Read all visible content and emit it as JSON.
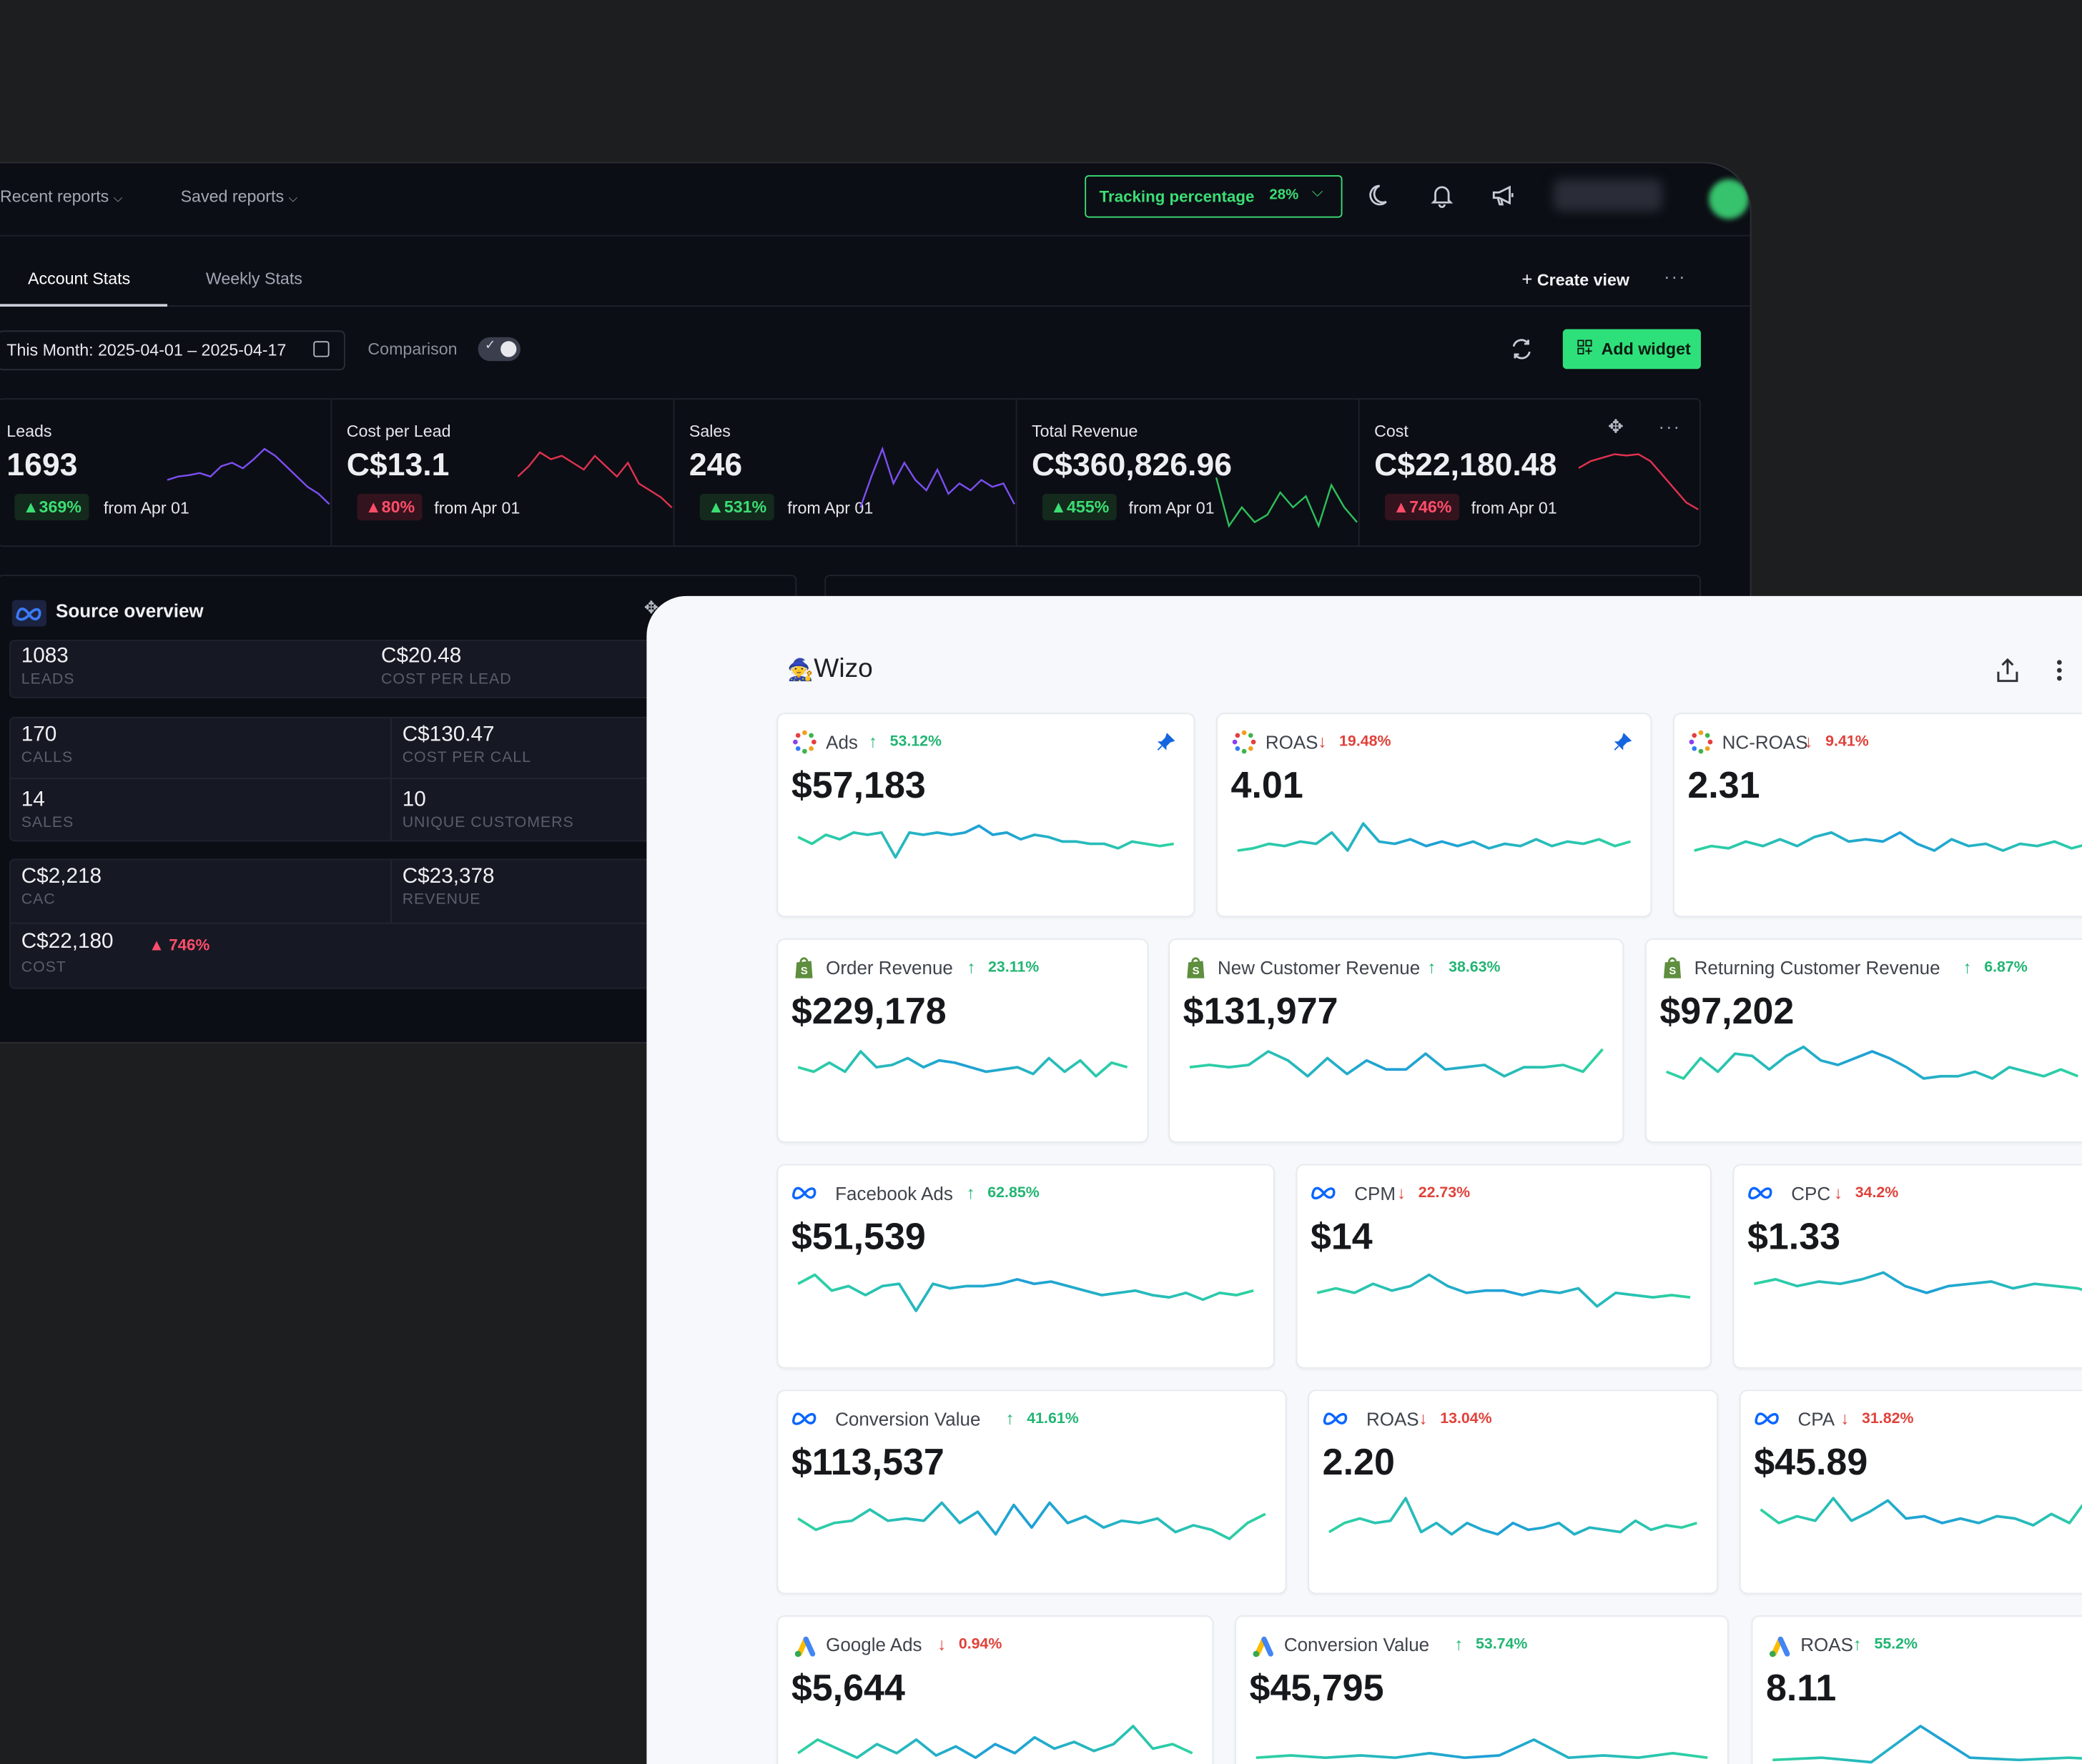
{
  "colors": {
    "accent_green": "#2ee07a",
    "up_green": "#3bde74",
    "down_red": "#ff4d6a",
    "light_up": "#22b573",
    "light_down": "#e0413a"
  },
  "dark_dashboard": {
    "nav": {
      "recent_reports": "Recent reports",
      "saved_reports": "Saved reports",
      "tracking_label": "Tracking percentage",
      "tracking_value": "28%"
    },
    "tabs": [
      "Account Stats",
      "Weekly Stats"
    ],
    "create_view": "Create view",
    "date_range": "This Month: 2025-04-01 – 2025-04-17",
    "comparison": "Comparison",
    "add_widget": "Add widget",
    "kpis": [
      {
        "label": "Leads",
        "value": "1693",
        "change": "369%",
        "dir": "up",
        "from": "from Apr 01",
        "trend": [
          0.55,
          0.5,
          0.48,
          0.45,
          0.5,
          0.35,
          0.3,
          0.38,
          0.25,
          0.1,
          0.2,
          0.35,
          0.5,
          0.65,
          0.75,
          0.9
        ]
      },
      {
        "label": "Cost per Lead",
        "value": "C$13.1",
        "change": "80%",
        "dir": "down",
        "from": "from Apr 01",
        "trend": [
          0.5,
          0.35,
          0.15,
          0.25,
          0.2,
          0.3,
          0.4,
          0.2,
          0.35,
          0.5,
          0.3,
          0.6,
          0.7,
          0.8,
          0.95
        ]
      },
      {
        "label": "Sales",
        "value": "246",
        "change": "531%",
        "dir": "up",
        "from": "from Apr 01",
        "trend": [
          0.95,
          0.5,
          0.1,
          0.6,
          0.3,
          0.55,
          0.7,
          0.4,
          0.75,
          0.6,
          0.7,
          0.55,
          0.65,
          0.6,
          0.9
        ]
      },
      {
        "label": "Total Revenue",
        "value": "C$360,826.96",
        "change": "455%",
        "dir": "up",
        "from": "from Apr 01",
        "trend": [
          0.3,
          0.95,
          0.7,
          0.9,
          0.8,
          0.5,
          0.7,
          0.55,
          0.95,
          0.4,
          0.7,
          0.9
        ]
      },
      {
        "label": "Cost",
        "value": "C$22,180.48",
        "change": "746%",
        "dir": "down",
        "from": "from Apr 01",
        "trend": [
          0.3,
          0.2,
          0.15,
          0.1,
          0.12,
          0.1,
          0.2,
          0.4,
          0.6,
          0.8,
          0.9
        ]
      }
    ],
    "source_overview": {
      "title": "Source overview",
      "rows": [
        {
          "v1": "1083",
          "l1": "LEADS",
          "v2": "C$20.48",
          "l2": "COST PER LEAD"
        },
        {
          "v1": "170",
          "l1": "CALLS",
          "v2": "C$130.47",
          "l2": "COST PER CALL"
        },
        {
          "v1": "14",
          "l1": "SALES",
          "v2": "10",
          "l2": "UNIQUE CUSTOMERS"
        },
        {
          "v1": "C$2,218",
          "l1": "CAC",
          "v2": "C$23,378",
          "l2": "REVENUE"
        },
        {
          "v1": "C$22,180",
          "l1": "COST",
          "badge": "746%"
        }
      ]
    }
  },
  "light_dashboard": {
    "brand": "Wizo",
    "cards": [
      {
        "icon": "ads-ring-icon",
        "title": "Ads",
        "change": "53.12%",
        "dir": "up",
        "value": "$57,183",
        "pinned": true,
        "series": [
          0.4,
          0.55,
          0.35,
          0.45,
          0.3,
          0.35,
          0.3,
          0.85,
          0.3,
          0.35,
          0.3,
          0.35,
          0.3,
          0.15,
          0.35,
          0.3,
          0.45,
          0.35,
          0.4,
          0.5,
          0.5,
          0.55,
          0.55,
          0.65,
          0.5,
          0.55,
          0.6,
          0.55
        ]
      },
      {
        "icon": "ads-ring-icon",
        "title": "ROAS",
        "change": "19.48%",
        "dir": "down",
        "value": "4.01",
        "pinned": true,
        "series": [
          0.7,
          0.65,
          0.55,
          0.6,
          0.5,
          0.55,
          0.3,
          0.7,
          0.1,
          0.5,
          0.55,
          0.45,
          0.6,
          0.5,
          0.6,
          0.5,
          0.65,
          0.55,
          0.6,
          0.45,
          0.6,
          0.5,
          0.55,
          0.45,
          0.6,
          0.5
        ]
      },
      {
        "icon": "ads-ring-icon",
        "title": "NC-ROAS",
        "change": "9.41%",
        "dir": "down",
        "value": "2.31",
        "pinned": false,
        "series": [
          0.7,
          0.6,
          0.65,
          0.5,
          0.6,
          0.45,
          0.6,
          0.4,
          0.3,
          0.5,
          0.45,
          0.5,
          0.3,
          0.55,
          0.7,
          0.45,
          0.6,
          0.55,
          0.7,
          0.55,
          0.6,
          0.5,
          0.65,
          0.55,
          0.6
        ]
      },
      {
        "icon": "shopify-icon",
        "title": "Order Revenue",
        "change": "23.11%",
        "dir": "up",
        "value": "$229,178",
        "pinned": false,
        "series": [
          0.5,
          0.6,
          0.4,
          0.6,
          0.15,
          0.5,
          0.45,
          0.3,
          0.5,
          0.35,
          0.4,
          0.5,
          0.6,
          0.55,
          0.5,
          0.65,
          0.3,
          0.6,
          0.35,
          0.7,
          0.4,
          0.5
        ]
      },
      {
        "icon": "shopify-icon",
        "title": "New Customer Revenue",
        "change": "38.63%",
        "dir": "up",
        "value": "$131,977",
        "pinned": false,
        "series": [
          0.5,
          0.45,
          0.5,
          0.45,
          0.15,
          0.35,
          0.7,
          0.3,
          0.65,
          0.35,
          0.55,
          0.55,
          0.2,
          0.55,
          0.5,
          0.45,
          0.7,
          0.5,
          0.5,
          0.45,
          0.6,
          0.1
        ]
      },
      {
        "icon": "shopify-icon",
        "title": "Returning Customer Revenue",
        "change": "6.87%",
        "dir": "up",
        "value": "$97,202",
        "pinned": false,
        "series": [
          0.6,
          0.75,
          0.3,
          0.6,
          0.2,
          0.25,
          0.55,
          0.25,
          0.05,
          0.35,
          0.45,
          0.3,
          0.15,
          0.3,
          0.5,
          0.75,
          0.7,
          0.7,
          0.6,
          0.75,
          0.5,
          0.6,
          0.7,
          0.55,
          0.7
        ]
      },
      {
        "icon": "meta-icon",
        "title": "Facebook Ads",
        "change": "62.85%",
        "dir": "up",
        "value": "$51,539",
        "pinned": false,
        "series": [
          0.3,
          0.1,
          0.45,
          0.35,
          0.55,
          0.35,
          0.3,
          0.9,
          0.3,
          0.4,
          0.35,
          0.35,
          0.3,
          0.2,
          0.3,
          0.25,
          0.35,
          0.45,
          0.55,
          0.5,
          0.45,
          0.55,
          0.6,
          0.5,
          0.65,
          0.5,
          0.55,
          0.45
        ]
      },
      {
        "icon": "meta-icon",
        "title": "CPM",
        "change": "22.73%",
        "dir": "down",
        "value": "$14",
        "pinned": false,
        "series": [
          0.5,
          0.4,
          0.5,
          0.3,
          0.45,
          0.35,
          0.1,
          0.35,
          0.5,
          0.45,
          0.45,
          0.55,
          0.45,
          0.5,
          0.4,
          0.8,
          0.5,
          0.55,
          0.6,
          0.55,
          0.6
        ]
      },
      {
        "icon": "meta-icon",
        "title": "CPC",
        "change": "34.2%",
        "dir": "down",
        "value": "$1.33",
        "pinned": false,
        "series": [
          0.3,
          0.2,
          0.35,
          0.25,
          0.3,
          0.2,
          0.05,
          0.35,
          0.5,
          0.35,
          0.3,
          0.25,
          0.4,
          0.3,
          0.35,
          0.4,
          0.55
        ]
      },
      {
        "icon": "meta-icon",
        "title": "Conversion Value",
        "change": "41.61%",
        "dir": "up",
        "value": "$113,537",
        "pinned": false,
        "series": [
          0.5,
          0.75,
          0.6,
          0.55,
          0.3,
          0.55,
          0.5,
          0.55,
          0.15,
          0.6,
          0.35,
          0.85,
          0.2,
          0.7,
          0.15,
          0.6,
          0.45,
          0.7,
          0.55,
          0.6,
          0.5,
          0.8,
          0.65,
          0.75,
          0.95,
          0.6,
          0.4
        ]
      },
      {
        "icon": "meta-icon",
        "title": "ROAS",
        "change": "13.04%",
        "dir": "down",
        "value": "2.20",
        "pinned": false,
        "series": [
          0.8,
          0.6,
          0.5,
          0.6,
          0.55,
          0.05,
          0.8,
          0.6,
          0.85,
          0.6,
          0.75,
          0.85,
          0.6,
          0.75,
          0.7,
          0.6,
          0.85,
          0.7,
          0.75,
          0.8,
          0.55,
          0.75,
          0.65,
          0.7,
          0.6
        ]
      },
      {
        "icon": "meta-icon",
        "title": "CPA",
        "change": "31.82%",
        "dir": "down",
        "value": "$45.89",
        "pinned": false,
        "series": [
          0.3,
          0.6,
          0.45,
          0.55,
          0.05,
          0.55,
          0.35,
          0.1,
          0.5,
          0.45,
          0.6,
          0.5,
          0.6,
          0.45,
          0.5,
          0.65,
          0.4,
          0.6,
          0.05,
          0.6
        ]
      },
      {
        "icon": "google-ads-icon",
        "title": "Google Ads",
        "change": "0.94%",
        "dir": "down",
        "value": "$5,644",
        "pinned": false,
        "series": [
          0.7,
          0.4,
          0.6,
          0.8,
          0.5,
          0.7,
          0.4,
          0.75,
          0.55,
          0.8,
          0.5,
          0.7,
          0.35,
          0.6,
          0.45,
          0.65,
          0.5,
          0.1,
          0.6,
          0.5,
          0.7
        ]
      },
      {
        "icon": "google-ads-icon",
        "title": "Conversion Value",
        "change": "53.74%",
        "dir": "up",
        "value": "$45,795",
        "pinned": false,
        "series": [
          0.8,
          0.75,
          0.8,
          0.75,
          0.8,
          0.7,
          0.8,
          0.75,
          0.4,
          0.8,
          0.75,
          0.8,
          0.7,
          0.8
        ]
      },
      {
        "icon": "google-ads-icon",
        "title": "ROAS",
        "change": "55.2%",
        "dir": "up",
        "value": "8.11",
        "pinned": false,
        "series": [
          0.85,
          0.8,
          0.9,
          0.1,
          0.8,
          0.85,
          0.8,
          0.85
        ]
      }
    ]
  }
}
